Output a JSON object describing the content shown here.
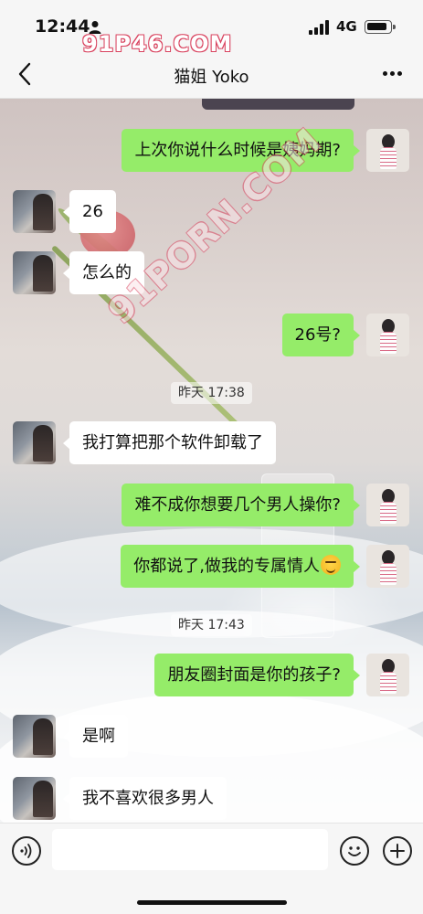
{
  "status_bar": {
    "time": "12:44",
    "network": "4G"
  },
  "watermark": {
    "top": "91P46.COM",
    "diagonal": "91PORN.COM"
  },
  "header": {
    "title": "猫姐 Yoko"
  },
  "messages": [
    {
      "side": "self",
      "text": "上次你说什么时候是姨妈期?"
    },
    {
      "side": "other",
      "text": "26"
    },
    {
      "side": "other",
      "text": "怎么的"
    },
    {
      "side": "self",
      "text": "26号?"
    },
    {
      "type": "time",
      "text": "昨天 17:38"
    },
    {
      "side": "other",
      "text": "我打算把那个软件卸载了"
    },
    {
      "side": "self",
      "text": "难不成你想要几个男人操你?"
    },
    {
      "side": "self",
      "text": "你都说了,做我的专属情人",
      "emoji": "grinning-face-emoji"
    },
    {
      "type": "time",
      "text": "昨天 17:43"
    },
    {
      "side": "self",
      "text": "朋友圈封面是你的孩子?"
    },
    {
      "side": "other",
      "text": "是啊"
    },
    {
      "side": "other",
      "text": "我不喜欢很多男人"
    }
  ],
  "input_bar": {
    "input_value": "",
    "icons": [
      "voice-icon",
      "emoji-icon",
      "plus-icon"
    ]
  },
  "colors": {
    "self_bubble": "#95ec69",
    "other_bubble": "#ffffff",
    "bar_background": "#f6f6f6"
  }
}
